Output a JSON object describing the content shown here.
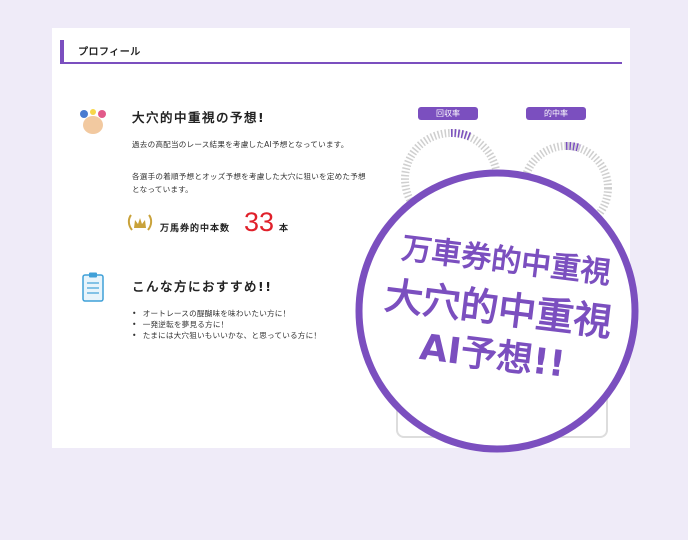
{
  "header": {
    "title": "プロフィール"
  },
  "intro": {
    "title": "大穴的中重視の予想!",
    "paragraph1": "過去の高配当のレース結果を考慮したAI予想となっています。",
    "paragraph2": "各選手の着順予想とオッズ予想を考慮した大穴に狙いを定めた予想となっています。",
    "stat_label": "万馬券的中本数",
    "stat_value": "33",
    "stat_unit": "本"
  },
  "recommend": {
    "title": "こんな方におすすめ!!",
    "items": [
      "オートレースの醍醐味を味わいたい方に！",
      "一発逆転を夢見る方に！",
      "たまには大穴狙いもいいかな、と思っている方に！"
    ]
  },
  "metrics": {
    "recovery_label": "回収率",
    "hit_label": "的中率"
  },
  "stamp": {
    "line1": "万車券的中重視",
    "line2": "大穴的中重視",
    "line3": "AI予想!!"
  },
  "colors": {
    "accent": "#7b4fbf",
    "stat_number": "#e0202a"
  }
}
